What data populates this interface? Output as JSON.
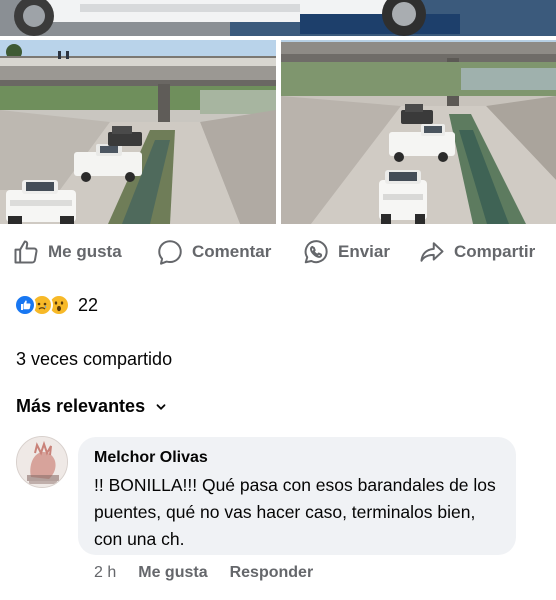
{
  "post": {
    "actions": {
      "like_label": "Me gusta",
      "comment_label": "Comentar",
      "send_label": "Enviar",
      "share_label": "Compartir"
    },
    "reactions": {
      "types": [
        "like",
        "sad",
        "wow"
      ],
      "count": "22"
    },
    "shares_text": "3 veces compartido",
    "sort_label": "Más relevantes"
  },
  "comment": {
    "author": "Melchor Olivas",
    "text": "!! BONILLA!!! Qué pasa con esos barandales de los puentes, qué no vas hacer caso, terminalos bien, con una ch.",
    "time": "2 h",
    "like_label": "Me gusta",
    "reply_label": "Responder"
  },
  "colors": {
    "accent": "#1877f2",
    "secondary_text": "#65676b",
    "bubble": "#f0f2f5"
  },
  "icons": {
    "like": "thumbs-up-icon",
    "comment": "speech-bubble-icon",
    "send": "whatsapp-icon",
    "share": "share-arrow-icon",
    "sort": "chevron-down-icon"
  }
}
